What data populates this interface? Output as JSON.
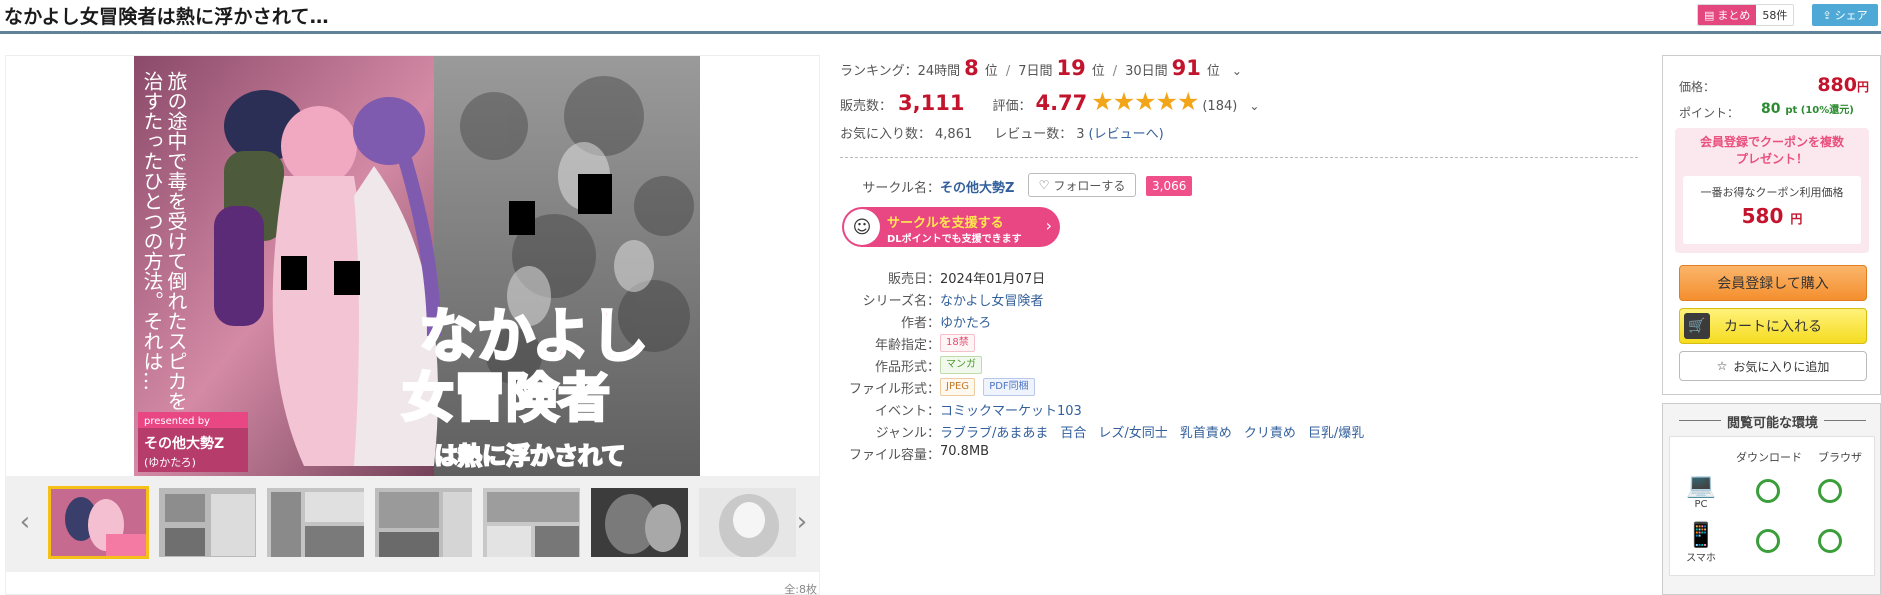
{
  "header": {
    "title": "なかよし女冒険者は熱に浮かされて…",
    "matome_label": "まとめ",
    "matome_count": "58件",
    "share_label": "シェア"
  },
  "gallery": {
    "cover_text_vertical_1": "旅の途中で毒を受けて倒れたスピカを",
    "cover_text_vertical_2": "治すたったひとつの方法。それは…",
    "cover_logo_line1": "なかよし",
    "cover_logo_line2": "女冒険者",
    "cover_logo_line3": "は熱に浮かされて",
    "cover_presented_by": "presented by",
    "cover_circle": "その他大勢Z",
    "cover_author": "(ゆかたろ)",
    "image_count": "全:8枚",
    "prev_arrow": "‹",
    "next_arrow": "›"
  },
  "ranking": {
    "label": "ランキング：",
    "period_24h": "24時間",
    "rank_24h": "8",
    "period_7d": "7日間",
    "rank_7d": "19",
    "period_30d": "30日間",
    "rank_30d": "91",
    "unit": "位",
    "sep": "/"
  },
  "stats": {
    "sales_label": "販売数：",
    "sales": "3,111",
    "rating_label": "評価：",
    "rating": "4.77",
    "stars": "★★★★★",
    "review_count": "(184)",
    "favorites_label": "お気に入り数：",
    "favorites": "4,861",
    "reviews_label": "レビュー数：",
    "reviews": "3",
    "reviews_link": "(レビューへ)"
  },
  "circle": {
    "label": "サークル名：",
    "name": "その他大勢Z",
    "follow_label": "フォローする",
    "follower_count": "3,066",
    "support_line1": "サークルを支援する",
    "support_line2": "DLポイントでも支援できます"
  },
  "details": {
    "release_label": "販売日：",
    "release_date": "2024年01月07日",
    "series_label": "シリーズ名：",
    "series": "なかよし女冒険者",
    "author_label": "作者：",
    "author": "ゆかたろ",
    "age_label": "年齢指定：",
    "age": "18禁",
    "format_label": "作品形式：",
    "format": "マンガ",
    "file_format_label": "ファイル形式：",
    "file_format_1": "JPEG",
    "file_format_2": "PDF同梱",
    "event_label": "イベント：",
    "event": "コミックマーケット103",
    "genre_label": "ジャンル：",
    "genres": [
      "ラブラブ/あまあま",
      "百合",
      "レズ/女同士",
      "乳首責め",
      "クリ責め",
      "巨乳/爆乳"
    ],
    "size_label": "ファイル容量：",
    "size": "70.8MB"
  },
  "purchase": {
    "price_label": "価格：",
    "price": "880",
    "price_unit": "円",
    "point_label": "ポイント：",
    "point": "80",
    "point_note": "pt (10%還元)",
    "coupon_title_1": "会員登録でクーポンを複数",
    "coupon_title_2": "プレゼント！",
    "coupon_note": "一番お得なクーポン利用価格",
    "coupon_price": "580",
    "coupon_unit": "円",
    "register_buy": "会員登録して購入",
    "cart": "カートに入れる",
    "favorite": "お気に入りに追加"
  },
  "environment": {
    "title": "閲覧可能な環境",
    "col_download": "ダウンロード",
    "col_browser": "ブラウザ",
    "device_pc": "PC",
    "device_phone": "スマホ"
  },
  "colors": {
    "price_red": "#c3142d",
    "accent_pink": "#e94783",
    "point_green": "#2c8b31",
    "star_orange": "#f3a51a",
    "link_blue": "#335f9c"
  }
}
